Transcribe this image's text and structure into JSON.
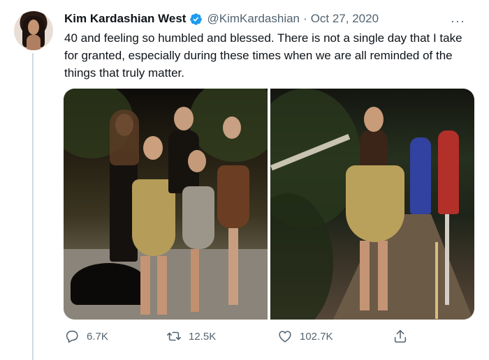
{
  "tweet": {
    "author_name": "Kim Kardashian West",
    "handle": "@KimKardashian",
    "separator": "·",
    "date": "Oct 27, 2020",
    "more": "···",
    "text": "40 and feeling so humbled and blessed. There is not a single day that I take for granted, especially during these times when we are all reminded of the things that truly matter.",
    "verified_color": "#1d9bf0"
  },
  "icons": {
    "avatar": "profile-photo",
    "verified": "verified-badge-icon",
    "reply": "reply-icon",
    "retweet": "retweet-icon",
    "like": "heart-icon",
    "share": "share-icon"
  },
  "actions": {
    "replies": "6.7K",
    "retweets": "12.5K",
    "likes": "102.7K"
  }
}
